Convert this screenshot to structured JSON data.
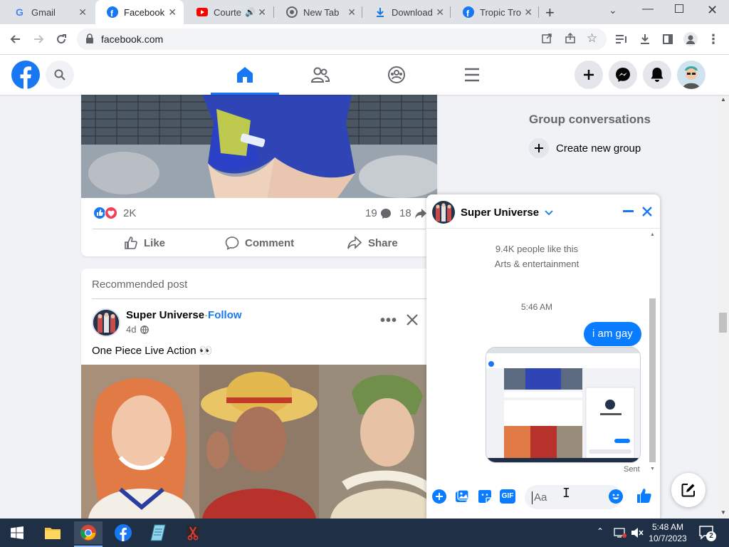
{
  "browser": {
    "tabs": [
      {
        "label": "Gmail",
        "icon": "gmail-icon"
      },
      {
        "label": "Facebook",
        "icon": "facebook-icon",
        "active": true
      },
      {
        "label": "Courte",
        "icon": "youtube-icon"
      },
      {
        "label": "New Tab",
        "icon": "chrome-icon"
      },
      {
        "label": "Download",
        "icon": "download-icon"
      },
      {
        "label": "Tropic Tro",
        "icon": "facebook-icon"
      }
    ],
    "new_tab": "+",
    "url": "facebook.com"
  },
  "feed": {
    "post1": {
      "reactions_count": "2K",
      "comments_count": "19",
      "shares_count": "18",
      "actions": {
        "like": "Like",
        "comment": "Comment",
        "share": "Share"
      }
    },
    "post2": {
      "header": "Recommended post",
      "author": "Super Universe",
      "dot": " · ",
      "follow": "Follow",
      "time": "4d",
      "text": "One Piece Live Action 👀"
    }
  },
  "sidebar": {
    "title": "Group conversations",
    "create_group": "Create new group"
  },
  "chat": {
    "name": "Super Universe",
    "likes": "9.4K people like this",
    "category": "Arts & entertainment",
    "timestamp": "5:46 AM",
    "message": "i am gay",
    "status": "Sent",
    "input_placeholder": "Aa",
    "gif_label": "GIF"
  },
  "taskbar": {
    "time": "5:48 AM",
    "date": "10/7/2023",
    "notifications": "2"
  },
  "colors": {
    "fb_blue": "#1877f2",
    "chrome_tab_bg": "#dee1e6",
    "taskbar": "#1f2f45"
  }
}
